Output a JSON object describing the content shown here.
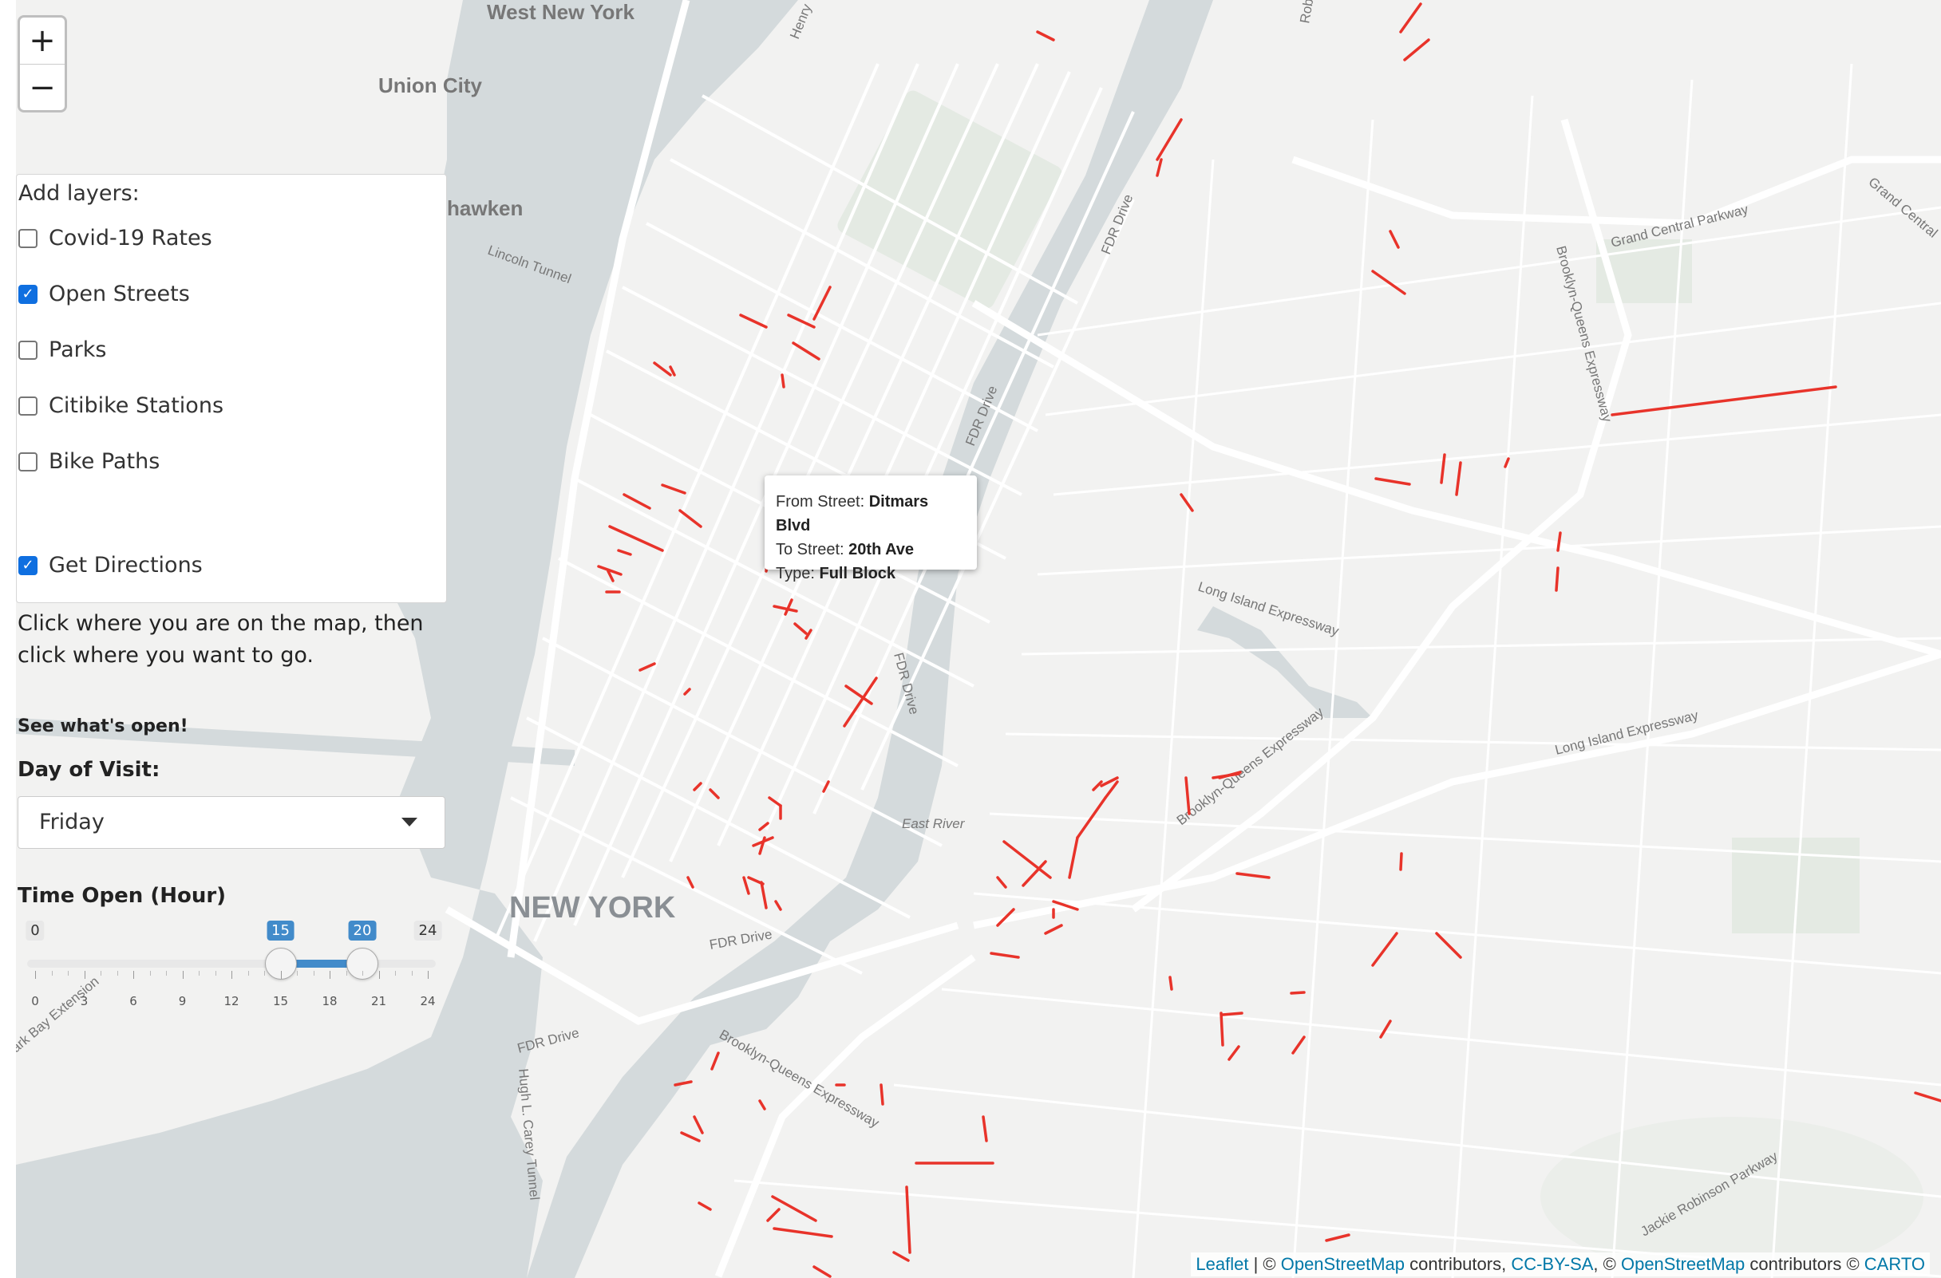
{
  "zoom": {
    "in_label": "+",
    "out_label": "−"
  },
  "layers": {
    "title": "Add layers:",
    "items": [
      {
        "label": "Covid-19 Rates",
        "checked": false
      },
      {
        "label": "Open Streets",
        "checked": true
      },
      {
        "label": "Parks",
        "checked": false
      },
      {
        "label": "Citibike Stations",
        "checked": false
      },
      {
        "label": "Bike Paths",
        "checked": false
      }
    ],
    "directions": {
      "label": "Get Directions",
      "checked": true
    }
  },
  "help_text": "Click where you are on the map, then click where you want to go.",
  "see_open": "See what's open!",
  "day": {
    "label": "Day of Visit:",
    "value": "Friday"
  },
  "time": {
    "label": "Time Open (Hour)",
    "min": 0,
    "max": 24,
    "from": 15,
    "to": 20,
    "min_label": "0",
    "max_label": "24",
    "from_label": "15",
    "to_label": "20",
    "ticks": [
      "0",
      "3",
      "6",
      "9",
      "12",
      "15",
      "18",
      "21",
      "24"
    ]
  },
  "tooltip": {
    "from_label": "From Street:",
    "from_value": "Ditmars Blvd",
    "to_label": "To Street:",
    "to_value": "20th Ave",
    "type_label": "Type:",
    "type_value": "Full Block"
  },
  "map_labels": [
    "West New York",
    "Union City",
    "hawken",
    "Lincoln Tunnel",
    "NEW YORK",
    "FDR Drive",
    "FDR Drive",
    "FDR Drive",
    "FDR Drive",
    "FDR Drive",
    "East River",
    "Long Island Expressway",
    "Long Island Expressway",
    "Brooklyn-Queens Expressway",
    "Brooklyn-Queens Expressway",
    "Brooklyn-Queens Expressway",
    "Grand Central Parkway",
    "Grand Central",
    "Jackie Robinson Parkway",
    "Henry",
    "Hugh L. Carey Tunnel",
    "ark Bay Extension",
    "Rob"
  ],
  "attribution": {
    "leaflet": "Leaflet",
    "sep1": " | © ",
    "osm1": "OpenStreetMap",
    "contrib1": " contributors, ",
    "ccbysa": "CC-BY-SA",
    "sep2": ", © ",
    "osm2": "OpenStreetMap",
    "contrib2": " contributors © ",
    "carto": "CARTO"
  },
  "colors": {
    "open_street": "#e8332a",
    "water": "#d4dadc",
    "park": "#e4eae3",
    "slider_accent": "#428bca"
  }
}
